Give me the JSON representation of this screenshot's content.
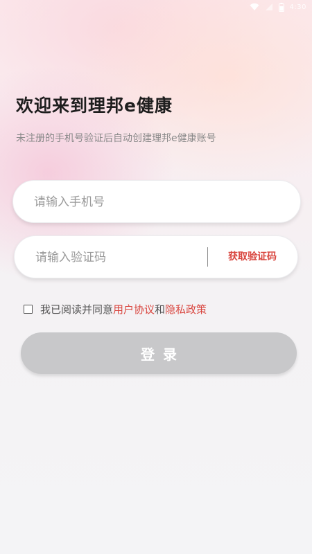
{
  "status_bar": {
    "time": "4:30",
    "icons": [
      "wifi-icon",
      "signal-icon",
      "battery-icon"
    ]
  },
  "header": {
    "title": "欢迎来到理邦e健康",
    "subtitle": "未注册的手机号验证后自动创建理邦e健康账号"
  },
  "form": {
    "phone_placeholder": "请输入手机号",
    "phone_value": "",
    "code_placeholder": "请输入验证码",
    "code_value": "",
    "get_code_label": "获取验证码"
  },
  "agreement": {
    "checked": false,
    "prefix": "我已阅读并同意",
    "user_agreement": "用户协议",
    "conjunction": "和",
    "privacy_policy": "隐私政策"
  },
  "login": {
    "label": "登录"
  },
  "colors": {
    "accent": "#d9463f",
    "title": "#1e1e1e",
    "subtitle": "#8a8a8a",
    "button_disabled": "#c8c8ca"
  }
}
